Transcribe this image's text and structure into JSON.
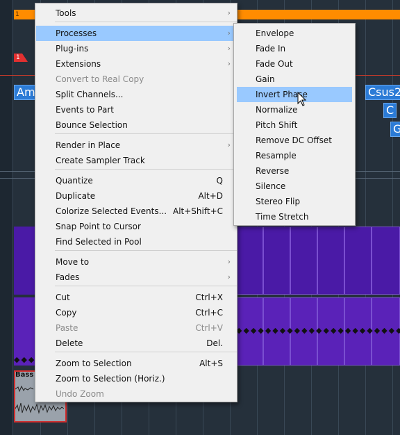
{
  "timeline": {
    "orange_track_number": "1",
    "marker_number": "1",
    "chords": [
      "Am",
      "Csus2",
      "C",
      "G"
    ],
    "bass_clip_label": "Bass"
  },
  "context_menu": {
    "items": [
      {
        "label": "Tools",
        "shortcut": "",
        "submenu": true,
        "disabled": false
      },
      {
        "label": "Processes",
        "shortcut": "",
        "submenu": true,
        "disabled": false,
        "highlighted": true
      },
      {
        "label": "Plug-ins",
        "shortcut": "",
        "submenu": true,
        "disabled": false
      },
      {
        "label": "Extensions",
        "shortcut": "",
        "submenu": true,
        "disabled": false
      },
      {
        "label": "Convert to Real Copy",
        "shortcut": "",
        "submenu": false,
        "disabled": true
      },
      {
        "label": "Split Channels...",
        "shortcut": "",
        "submenu": false,
        "disabled": false
      },
      {
        "label": "Events to Part",
        "shortcut": "",
        "submenu": false,
        "disabled": false
      },
      {
        "label": "Bounce Selection",
        "shortcut": "",
        "submenu": false,
        "disabled": false
      },
      {
        "label": "Render in Place",
        "shortcut": "",
        "submenu": true,
        "disabled": false
      },
      {
        "label": "Create Sampler Track",
        "shortcut": "",
        "submenu": false,
        "disabled": false
      },
      {
        "label": "Quantize",
        "shortcut": "Q",
        "submenu": false,
        "disabled": false
      },
      {
        "label": "Duplicate",
        "shortcut": "Alt+D",
        "submenu": false,
        "disabled": false
      },
      {
        "label": "Colorize Selected Events...",
        "shortcut": "Alt+Shift+C",
        "submenu": false,
        "disabled": false
      },
      {
        "label": "Snap Point to Cursor",
        "shortcut": "",
        "submenu": false,
        "disabled": false
      },
      {
        "label": "Find Selected in Pool",
        "shortcut": "",
        "submenu": false,
        "disabled": false
      },
      {
        "label": "Move to",
        "shortcut": "",
        "submenu": true,
        "disabled": false
      },
      {
        "label": "Fades",
        "shortcut": "",
        "submenu": true,
        "disabled": false
      },
      {
        "label": "Cut",
        "shortcut": "Ctrl+X",
        "submenu": false,
        "disabled": false
      },
      {
        "label": "Copy",
        "shortcut": "Ctrl+C",
        "submenu": false,
        "disabled": false
      },
      {
        "label": "Paste",
        "shortcut": "Ctrl+V",
        "submenu": false,
        "disabled": true
      },
      {
        "label": "Delete",
        "shortcut": "Del.",
        "submenu": false,
        "disabled": false
      },
      {
        "label": "Zoom to Selection",
        "shortcut": "Alt+S",
        "submenu": false,
        "disabled": false
      },
      {
        "label": "Zoom to Selection (Horiz.)",
        "shortcut": "",
        "submenu": false,
        "disabled": false
      },
      {
        "label": "Undo Zoom",
        "shortcut": "",
        "submenu": false,
        "disabled": true
      }
    ]
  },
  "processes_submenu": {
    "items": [
      {
        "label": "Envelope"
      },
      {
        "label": "Fade In"
      },
      {
        "label": "Fade Out"
      },
      {
        "label": "Gain"
      },
      {
        "label": "Invert Phase",
        "highlighted": true
      },
      {
        "label": "Normalize"
      },
      {
        "label": "Pitch Shift"
      },
      {
        "label": "Remove DC Offset"
      },
      {
        "label": "Resample"
      },
      {
        "label": "Reverse"
      },
      {
        "label": "Silence"
      },
      {
        "label": "Stereo Flip"
      },
      {
        "label": "Time Stretch"
      }
    ]
  },
  "colors": {
    "highlight": "#99c9ff",
    "menu_bg": "#f0f0f0",
    "track_orange": "#ff8c00",
    "chord_blue": "#2b7bd6",
    "event_purple": "#5a22b8"
  }
}
